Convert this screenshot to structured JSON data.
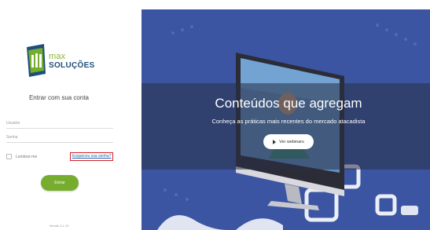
{
  "brand": {
    "logo_word_1": "max",
    "logo_word_2": "SOLUÇÕES",
    "colors": {
      "green": "#76ad2f",
      "blue": "#1e4f7a"
    }
  },
  "login": {
    "title": "Entrar com sua conta",
    "user_placeholder": "Usuário",
    "password_placeholder": "Senha",
    "remember_label": "Lembrar-me",
    "forgot_label": "Esqueceu sua senha?",
    "submit_label": "Entrar",
    "version": "Versão 3.1.13"
  },
  "hero": {
    "title": "Conteúdos que agregam",
    "subtitle": "Conheça as práticas mais recentes do mercado atacadista",
    "button_label": "Ver webinars",
    "button_icon": "play-icon",
    "colors": {
      "background": "#3a4f9c",
      "band": "#283046"
    }
  }
}
